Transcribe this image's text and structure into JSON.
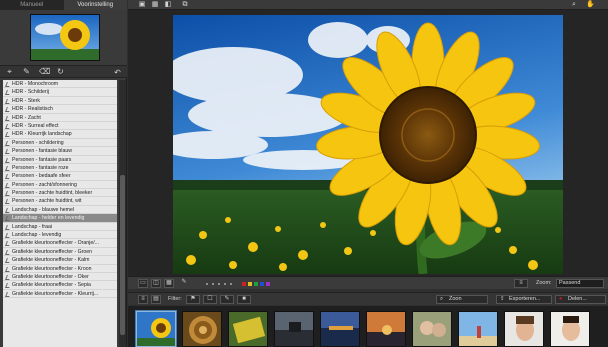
{
  "tabs": [
    {
      "label": "Manueel",
      "active": false
    },
    {
      "label": "Voorinstelling",
      "active": true
    }
  ],
  "presets": [
    {
      "label": "HDR - Monochroom"
    },
    {
      "label": "HDR - Schilderij"
    },
    {
      "label": "HDR - Sterk"
    },
    {
      "label": "HDR - Realistisch"
    },
    {
      "label": "HDR - Zacht"
    },
    {
      "label": "HDR - Surreal effect"
    },
    {
      "label": "HDR - Kleurrijk landschap"
    },
    {
      "label": "Personen - schildering"
    },
    {
      "label": "Personen - fantasie blauw"
    },
    {
      "label": "Personen - fantasie paars"
    },
    {
      "label": "Personen - fantasie roze"
    },
    {
      "label": "Personen - bedaafe sfeer"
    },
    {
      "label": "Personen - zacht/sfonnering"
    },
    {
      "label": "Personen - zachte huidtint, bleeker"
    },
    {
      "label": "Personen - zachte huidtint, wit"
    },
    {
      "label": "Landschap - blauwe hemel"
    },
    {
      "label": "Landschap - helder en levendig"
    },
    {
      "label": "Landschap - fraai"
    },
    {
      "label": "Landschap - levendig"
    },
    {
      "label": "Grafiekte kleurtooneffecter - Oranje/..."
    },
    {
      "label": "Grafiekte kleurtooneffecter - Groen"
    },
    {
      "label": "Grafiekte kleurtooneffecter - Kalm"
    },
    {
      "label": "Grafiekte kleurtooneffecter - Kroon"
    },
    {
      "label": "Grafiekte kleurtooneffecter - Oker"
    },
    {
      "label": "Grafiekte kleurtooneffecter - Sepia"
    },
    {
      "label": "Grafiekte kleurtooneffecter - Kleurrij..."
    }
  ],
  "selected_preset_index": 16,
  "viewbar": {
    "zoom_label": "Zoom:",
    "zoom_value": "Passend",
    "swatch_colors": [
      "#d02020",
      "#e0c020",
      "#20a040",
      "#2050d0",
      "#a030c0"
    ]
  },
  "filterbar": {
    "filter_label": "Filter:",
    "zoom_dropdown": "Zoon",
    "export_label": "Exporteren...",
    "share_label": "Delen..."
  },
  "icons": {
    "top_left": [
      "fit-view-icon",
      "grid-view-icon",
      "compare-icon",
      "fullscreen-icon"
    ],
    "top_right": [
      "search-icon",
      "hand-icon"
    ],
    "left_tools": [
      "pin-icon",
      "brush-icon",
      "eraser-icon",
      "refresh-icon"
    ]
  }
}
